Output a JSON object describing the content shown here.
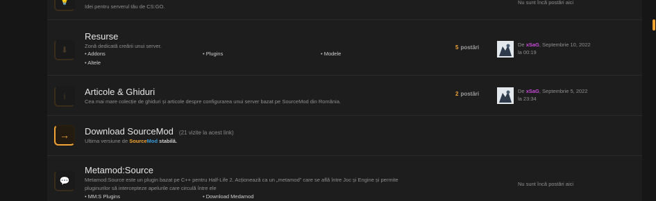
{
  "forums": [
    {
      "desc": "Idei pentru serverul tău de CS:GO.",
      "last_post_none": "Nu sunt încă postări aici"
    },
    {
      "title": "Resurse",
      "desc": "Zonă dedicată creării unui server.",
      "subforums": [
        "Addons",
        "Plugins",
        "Modele",
        "Altele"
      ],
      "posts_count": "5",
      "posts_label": "postări",
      "last_post": {
        "prefix": "De",
        "user": "xSaG",
        "date": ", Septembrie 10, 2022",
        "time": "la 00:19"
      }
    },
    {
      "title": "Articole & Ghiduri",
      "desc": "Cea mai mare colecție de ghiduri și articole despre configurarea unui server bazat pe SourceMod din România.",
      "posts_count": "2",
      "posts_label": "postări",
      "last_post": {
        "prefix": "De",
        "user": "xSaG",
        "date": ", Septembrie 5, 2022",
        "time": "la 23:34"
      }
    },
    {
      "title": "Download SourceMod",
      "visits": "(21 vizite la acest link)",
      "desc_prefix": "Ultima versiune de",
      "desc_brand1": "Source",
      "desc_brand2": "Mod",
      "desc_suffix": "stabilă."
    },
    {
      "title": "Metamod:Source",
      "desc_line1": "Metamod:Source este un plugin bazat pe C++ pentru Half-Life 2. Acționează ca un „metamod” care se află între Joc și Engine și permite",
      "desc_line2": "pluginurilor să intercepteze apelurile care circulă între ele",
      "subforums": [
        "MM:S Plugins",
        "Download Medamod"
      ],
      "last_post_none": "Nu sunt încă postări aici"
    }
  ],
  "colors": {
    "accent": "#f2a534",
    "user": "#c84ad8",
    "brand_blue": "#3a9bd8"
  }
}
